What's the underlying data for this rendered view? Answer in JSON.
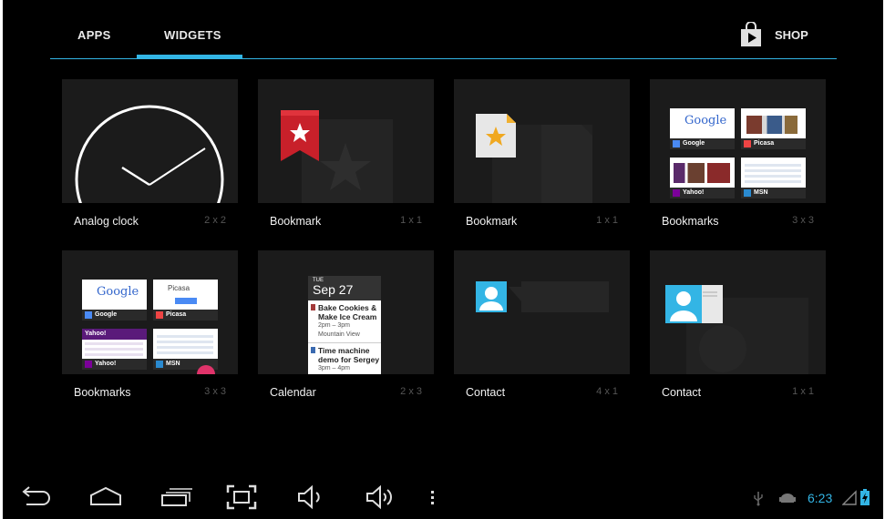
{
  "tabs": {
    "apps": "APPS",
    "widgets": "WIDGETS",
    "shop": "SHOP"
  },
  "widgets": [
    {
      "name": "Analog clock",
      "size": "2 x 2"
    },
    {
      "name": "Bookmark",
      "size": "1 x 1"
    },
    {
      "name": "Bookmark",
      "size": "1 x 1"
    },
    {
      "name": "Bookmarks",
      "size": "3 x 3"
    },
    {
      "name": "Bookmarks",
      "size": "3 x 3"
    },
    {
      "name": "Calendar",
      "size": "2 x 3"
    },
    {
      "name": "Contact",
      "size": "4 x 1"
    },
    {
      "name": "Contact",
      "size": "1 x 1"
    }
  ],
  "bookmark_previews": {
    "google": "Google",
    "picasa": "Picasa",
    "yahoo": "Yahoo!",
    "msn": "MSN",
    "google_logo": "Google",
    "yahoo_logo": "Yahoo!"
  },
  "calendar_preview": {
    "day": "TUE",
    "date": "Sep 27",
    "events": [
      {
        "title1": "Bake Cookies &",
        "title2": "Make Ice Cream",
        "time": "2pm – 3pm",
        "location": "Mountain View"
      },
      {
        "title1": "Time machine",
        "title2": "demo for Sergey",
        "time": "3pm – 4pm"
      }
    ]
  },
  "status_bar": {
    "time": "6:23"
  },
  "colors": {
    "accent": "#33b5e5",
    "tile_bg": "#1b1b1b",
    "background": "#000000"
  },
  "icons": [
    "back-icon",
    "home-icon",
    "recent-apps-icon",
    "screenshot-icon",
    "volume-down-icon",
    "volume-up-icon",
    "menu-icon",
    "usb-icon",
    "android-debug-icon",
    "signal-icon",
    "battery-icon",
    "shop-bag-icon"
  ]
}
